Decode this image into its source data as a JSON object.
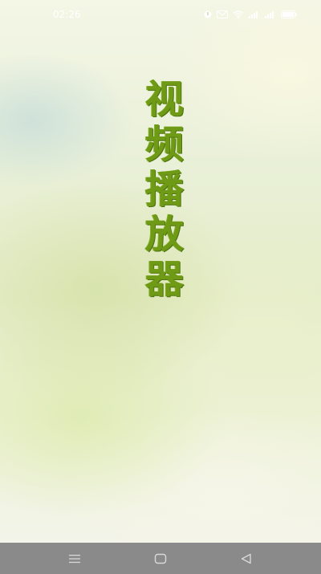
{
  "status_bar": {
    "time": "02:26",
    "icons": [
      "notification-icon",
      "message-icon",
      "wifi-icon",
      "signal-icon",
      "signal-icon",
      "battery-icon"
    ]
  },
  "splash": {
    "title": "视频播放器",
    "title_color": "#6f9a16"
  },
  "nav_bar": {
    "background": "#8a8a8a",
    "buttons": [
      "menu-icon",
      "home-icon",
      "back-icon"
    ]
  }
}
